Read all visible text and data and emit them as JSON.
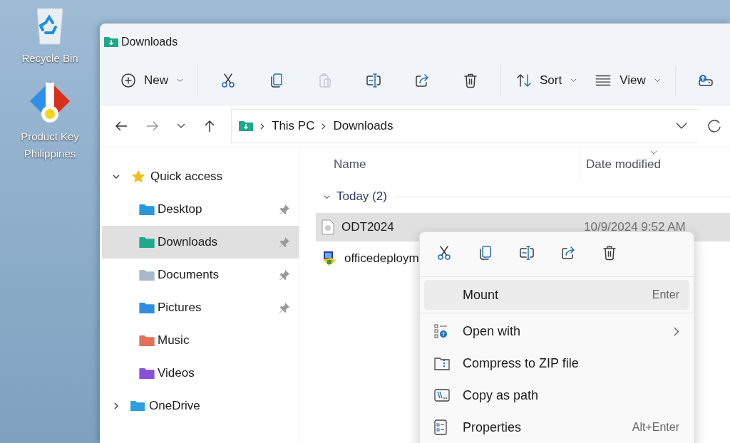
{
  "desktop_icons": [
    {
      "label": "Recycle Bin",
      "kind": "bin"
    },
    {
      "label": "Product Key Philippines",
      "kind": "key"
    }
  ],
  "window": {
    "title": "Downloads"
  },
  "toolbar": {
    "items": [
      {
        "kind": "new",
        "label": "New",
        "disabled": false
      },
      {
        "kind": "cut",
        "disabled": false
      },
      {
        "kind": "copy",
        "disabled": false
      },
      {
        "kind": "paste",
        "disabled": true
      },
      {
        "kind": "rename",
        "disabled": false
      },
      {
        "kind": "share",
        "disabled": false
      },
      {
        "kind": "delete",
        "disabled": false
      },
      {
        "kind": "sort",
        "label": "Sort",
        "disabled": false
      },
      {
        "kind": "view",
        "label": "View",
        "disabled": false
      },
      {
        "kind": "drive",
        "disabled": false
      }
    ]
  },
  "address": {
    "segments": [
      "This PC",
      "Downloads"
    ]
  },
  "sidebar": {
    "items": [
      {
        "label": "Quick access",
        "kind": "star",
        "expanded": true,
        "selected": false,
        "children": [
          {
            "label": "Desktop",
            "kind": "desktop",
            "pinned": true,
            "selected": false
          },
          {
            "label": "Downloads",
            "kind": "downloads",
            "pinned": true,
            "selected": true
          },
          {
            "label": "Documents",
            "kind": "documents",
            "pinned": true,
            "selected": false
          },
          {
            "label": "Pictures",
            "kind": "pictures",
            "pinned": true,
            "selected": false
          },
          {
            "label": "Music",
            "kind": "music",
            "pinned": false,
            "selected": false
          },
          {
            "label": "Videos",
            "kind": "videos",
            "pinned": false,
            "selected": false
          }
        ]
      },
      {
        "label": "OneDrive",
        "kind": "onedrive",
        "expanded": false,
        "selected": false
      }
    ]
  },
  "columns": [
    "Name",
    "Date modified"
  ],
  "groups": [
    {
      "label": "Today (2)",
      "expanded": true,
      "files": [
        {
          "name": "ODT2024",
          "date": "10/9/2024 9:52 AM",
          "kind": "disc",
          "selected": true
        },
        {
          "name": "officedeploym",
          "kind": "setup",
          "selected": false
        }
      ]
    }
  ],
  "context_menu": {
    "actions": [
      {
        "kind": "cut"
      },
      {
        "kind": "copy"
      },
      {
        "kind": "rename"
      },
      {
        "kind": "share"
      },
      {
        "kind": "delete"
      }
    ],
    "items": [
      {
        "label": "Mount",
        "shortcut": "Enter",
        "kind": "plain",
        "selected": true,
        "separator_after": true
      },
      {
        "label": "Open with",
        "kind": "openwith",
        "submenu": true,
        "selected": false
      },
      {
        "label": "Compress to ZIP file",
        "kind": "zip",
        "selected": false
      },
      {
        "label": "Copy as path",
        "kind": "path",
        "selected": false
      },
      {
        "label": "Properties",
        "shortcut": "Alt+Enter",
        "kind": "props",
        "selected": false
      }
    ]
  }
}
